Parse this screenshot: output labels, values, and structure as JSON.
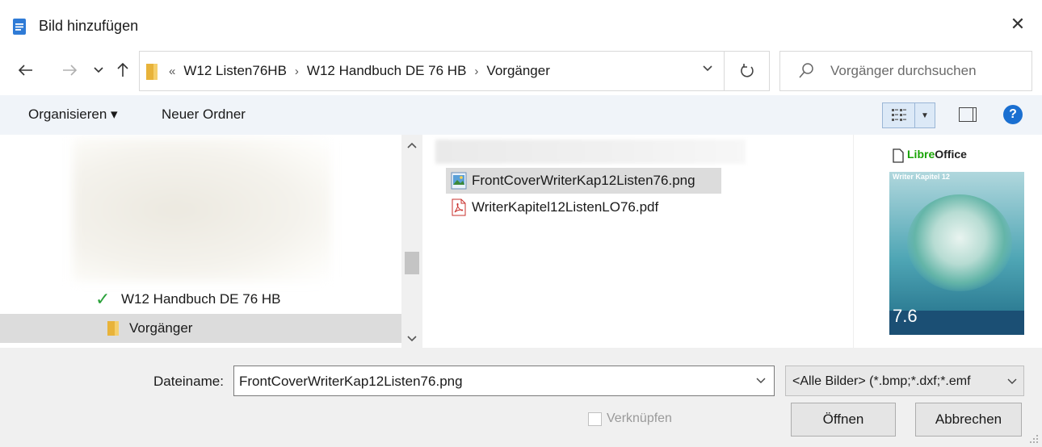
{
  "window": {
    "title": "Bild hinzufügen",
    "close_glyph": "✕"
  },
  "nav": {
    "back_icon": "arrow-left-icon",
    "forward_icon": "arrow-right-icon",
    "recent_icon": "chevron-down-icon",
    "up_icon": "arrow-up-icon",
    "breadcrumb": {
      "overflow": "«",
      "items": [
        "W12 Listen76HB",
        "W12 Handbuch DE 76 HB",
        "Vorgänger"
      ],
      "separator": "›"
    },
    "search": {
      "placeholder": "Vorgänger durchsuchen"
    }
  },
  "toolbar": {
    "organize_label": "Organisieren ▾",
    "new_folder_label": "Neuer Ordner",
    "help_label": "?"
  },
  "tree": {
    "items": [
      {
        "label": "W12 Handbuch DE 76 HB",
        "icon": "check-icon",
        "selected": false
      },
      {
        "label": "Vorgänger",
        "icon": "folder-icon",
        "selected": true
      }
    ]
  },
  "files": [
    {
      "name": "FrontCoverWriterKap12Listen76.png",
      "icon": "image-file-icon",
      "selected": true
    },
    {
      "name": "WriterKapitel12ListenLO76.pdf",
      "icon": "pdf-file-icon",
      "selected": false
    }
  ],
  "preview": {
    "brand_libre": "Libre",
    "brand_office": "Office",
    "subtitle": "Writer Kapitel 12",
    "version": "7.6"
  },
  "bottom": {
    "filename_label": "Dateiname:",
    "filename_value": "FrontCoverWriterKap12Listen76.png",
    "filter_value": "<Alle Bilder> (*.bmp;*.dxf;*.emf",
    "link_label": "Verknüpfen",
    "open_label": "Öffnen",
    "cancel_label": "Abbrechen"
  },
  "colors": {
    "accent": "#1a6fd1",
    "check": "#2aa13a",
    "toolbar_bg": "#f0f4f9",
    "selection": "#dcdcdc"
  }
}
